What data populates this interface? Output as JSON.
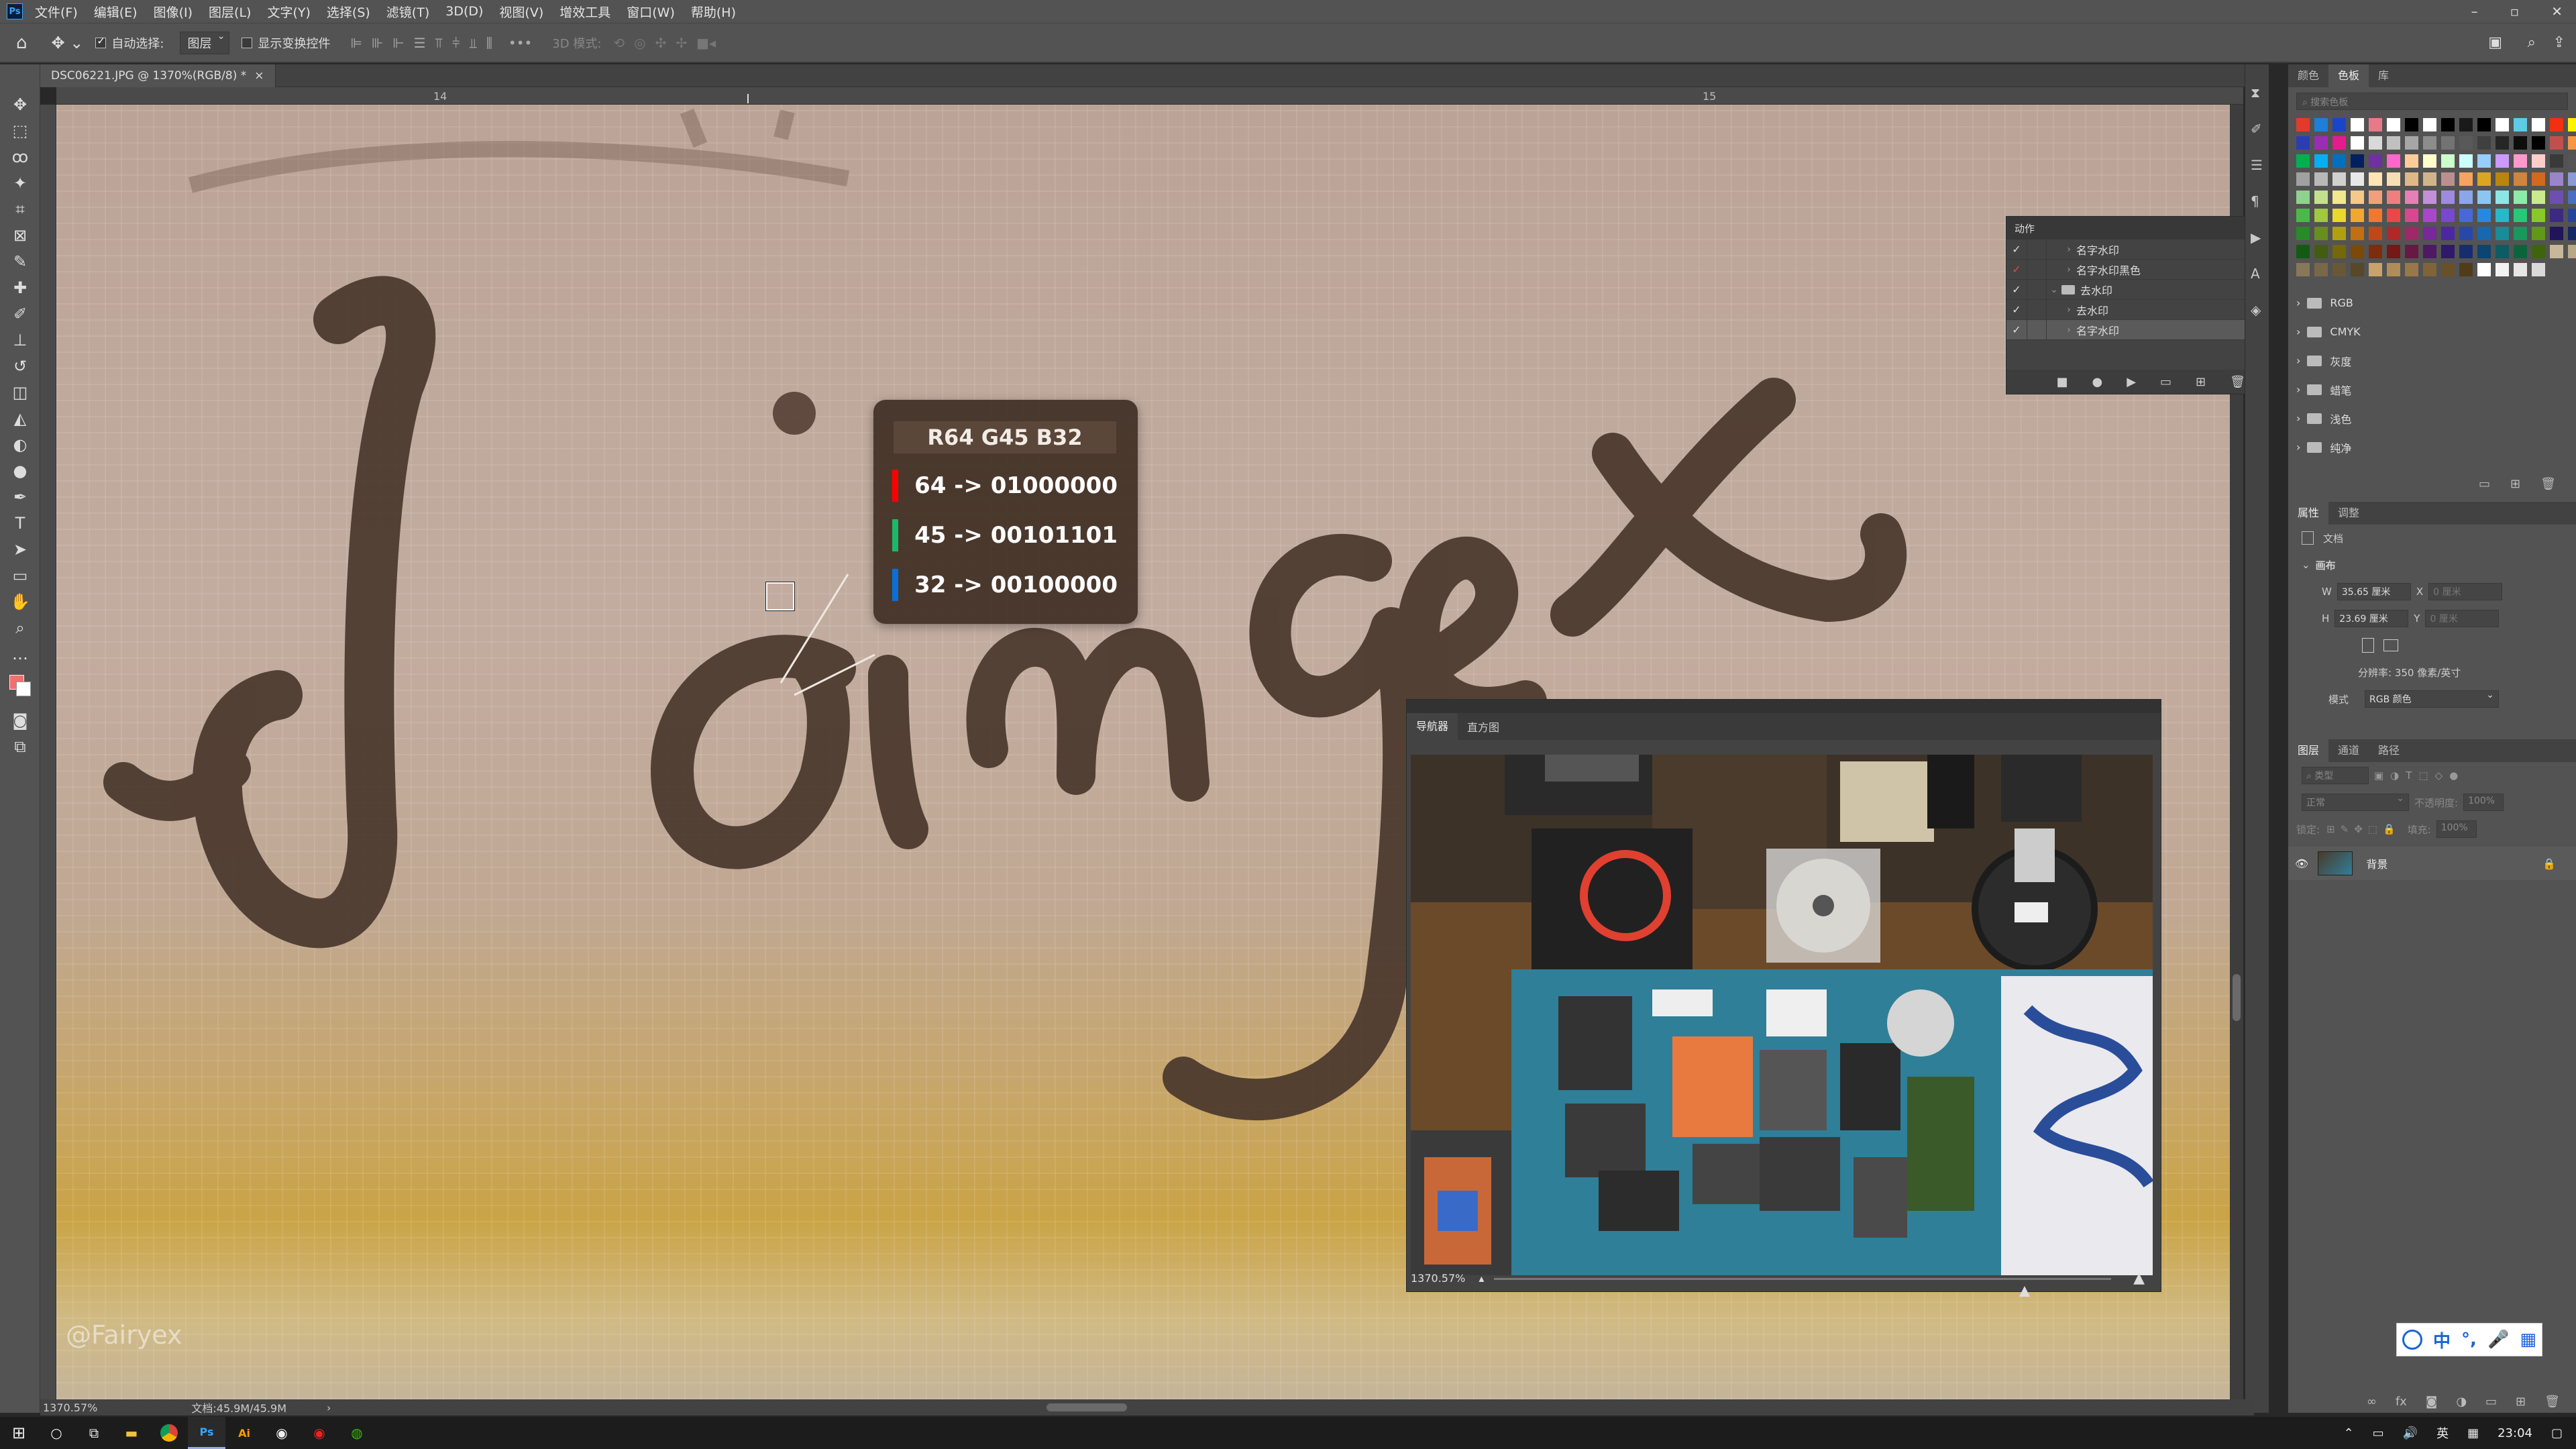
{
  "menubar": {
    "app_icon": "Ps",
    "items": [
      "文件(F)",
      "编辑(E)",
      "图像(I)",
      "图层(L)",
      "文字(Y)",
      "选择(S)",
      "滤镜(T)",
      "3D(D)",
      "视图(V)",
      "增效工具",
      "窗口(W)",
      "帮助(H)"
    ]
  },
  "window_controls": [
    "–",
    "▫",
    "✕"
  ],
  "options": {
    "auto_select_label": "自动选择:",
    "auto_select_value": "图层",
    "show_transform_label": "显示变换控件",
    "mode_3d_label": "3D 模式:"
  },
  "document": {
    "tab_title": "DSC06221.JPG @ 1370%(RGB/8) *",
    "close_glyph": "×"
  },
  "ruler": {
    "tick_14": "14",
    "tick_15": "15"
  },
  "canvas": {
    "handwriting": "Jamex",
    "watermark": "@Fairyex"
  },
  "pixel_info": {
    "header": "R64 G45 B32",
    "rows": [
      {
        "color": "#ff0000",
        "text": "64 -> 01000000"
      },
      {
        "color": "#1cb86a",
        "text": "45 -> 00101101"
      },
      {
        "color": "#0a6fd8",
        "text": "32 -> 00100000"
      }
    ]
  },
  "actions_panel": {
    "title": "动作",
    "rows": [
      {
        "label": "名字水印",
        "check": "✓",
        "twisty": "›",
        "indent": 1
      },
      {
        "label": "名字水印黑色",
        "check": "✓",
        "twisty": "›",
        "indent": 1
      },
      {
        "label": "去水印",
        "check": "✓",
        "twisty": "⌄",
        "indent": 0
      },
      {
        "label": "去水印",
        "check": "✓",
        "twisty": "›",
        "indent": 1
      },
      {
        "label": "名字水印",
        "check": "✓",
        "twisty": "›",
        "indent": 1
      }
    ]
  },
  "navigator": {
    "tabs": [
      "导航器",
      "直方图"
    ],
    "zoom": "1370.57%",
    "zoom_fraction": 0.86
  },
  "right_panel": {
    "swatch_tabs": [
      "颜色",
      "色板",
      "库"
    ],
    "swatch_search_placeholder": "搜索色板",
    "swatch_colors": [
      "#e23b2c",
      "#1f7ed8",
      "#1846c8",
      "#ffffff",
      "#e87a87",
      "#ffffff",
      "#000000",
      "#ffffff",
      "#000000",
      "#1a1a1a",
      "#000000",
      "#ffffff",
      "#5ecbe6",
      "#ffffff",
      "#f03010",
      "#fff200",
      "#8cc63f",
      "#4fc1e9",
      "#2b3db3",
      "#9b2db3",
      "#e31c8e",
      "#ffffff",
      "#d9d9d9",
      "#c0c0c0",
      "#a6a6a6",
      "#8c8c8c",
      "#737373",
      "#595959",
      "#404040",
      "#262626",
      "#0d0d0d",
      "#000000",
      "#c0504d",
      "#f79646",
      "#ffff00",
      "#92d050",
      "#00b050",
      "#00b0f0",
      "#0070c0",
      "#002060",
      "#7030a0",
      "#ff66cc",
      "#ffcc99",
      "#ffffcc",
      "#ccffcc",
      "#ccffff",
      "#99ccff",
      "#cc99ff",
      "#ff99cc",
      "#ffcccc",
      "#3a3a3a",
      "#555555",
      "#6e6e6e",
      "#888888",
      "#a0a0a0",
      "#b8b8b8",
      "#d0d0d0",
      "#e8e8e8",
      "#ffe4b5",
      "#f5deb3",
      "#deb887",
      "#d2b48c",
      "#bc8f8f",
      "#f4a460",
      "#daa520",
      "#b8860b",
      "#cd853f",
      "#d2691e",
      "#9b85c9",
      "#8a9bd6",
      "#7cb6e8",
      "#7dd3c0",
      "#8fd18f",
      "#c3e08c",
      "#f2e88c",
      "#f5c987",
      "#f2a07b",
      "#ee7f7f",
      "#e67fb5",
      "#c48fd9",
      "#a08ae0",
      "#8ca6eb",
      "#8cc6f0",
      "#8ce6e6",
      "#8ceba8",
      "#c8eb8c",
      "#6d4fb0",
      "#4a6ec4",
      "#2f95d9",
      "#2bb5a8",
      "#4cb84c",
      "#a0c840",
      "#e8d830",
      "#f0a830",
      "#f07830",
      "#e84848",
      "#d84890",
      "#a848c8",
      "#7848d0",
      "#4868d8",
      "#2888e0",
      "#28b8c8",
      "#28c878",
      "#88c828",
      "#3c2a80",
      "#28449a",
      "#18689e",
      "#188a80",
      "#288a28",
      "#688e20",
      "#b0a010",
      "#c07010",
      "#c04818",
      "#b02828",
      "#a02868",
      "#782898",
      "#4c28a0",
      "#2848a8",
      "#1868b0",
      "#188c98",
      "#18985c",
      "#609818",
      "#201558",
      "#142864",
      "#0c406a",
      "#0c5a54",
      "#145a14",
      "#445c10",
      "#746808",
      "#7e4808",
      "#7e2c0c",
      "#741818",
      "#681844",
      "#4e1864",
      "#30186a",
      "#182c70",
      "#0c4474",
      "#0c5c64",
      "#0c643c",
      "#3e640c",
      "#c8b89a",
      "#b8a888",
      "#a89878",
      "#988868",
      "#887858",
      "#786848",
      "#685838",
      "#584828",
      "#c9a36b",
      "#b08c58",
      "#987848",
      "#806438",
      "#685028",
      "#503c18",
      "#ffffff",
      "#f2f2f2",
      "#e6e6e6",
      "#d9d9d9"
    ],
    "swatch_folders": [
      "RGB",
      "CMYK",
      "灰度",
      "蜡笔",
      "浅色",
      "纯净"
    ],
    "properties_tabs": [
      "属性",
      "调整"
    ],
    "doc_label": "文档",
    "canvas_section": "画布",
    "w_label": "W",
    "w_value": "35.65 厘米",
    "h_label": "H",
    "h_value": "23.69 厘米",
    "x_label": "X",
    "x_placeholder": "0 厘米",
    "y_label": "Y",
    "y_placeholder": "0 厘米",
    "resolution": "分辨率: 350 像素/英寸",
    "mode_label": "模式",
    "mode_value": "RGB 颜色",
    "layers_tabs": [
      "图层",
      "通道",
      "路径"
    ],
    "layer_filter_placeholder": "类型",
    "blend_mode": "正常",
    "opacity_label": "不透明度:",
    "opacity_value": "100%",
    "lock_label": "锁定:",
    "fill_label": "填充:",
    "fill_value": "100%",
    "layer_name": "背景"
  },
  "status": {
    "zoom": "1370.57%",
    "doc_size": "文档:45.9M/45.9M",
    "arrow": "›"
  },
  "taskbar": {
    "clock": "23:04",
    "lang": "英",
    "icons": [
      "windows-icon",
      "search-icon",
      "task-view-icon",
      "file-explorer-icon",
      "chrome-icon",
      "photoshop-icon",
      "illustrator-icon",
      "music-icon",
      "netease-icon",
      "wechat-icon"
    ]
  },
  "ime": {
    "glyphs": [
      "中",
      "°,",
      "🎤",
      "▦"
    ]
  }
}
